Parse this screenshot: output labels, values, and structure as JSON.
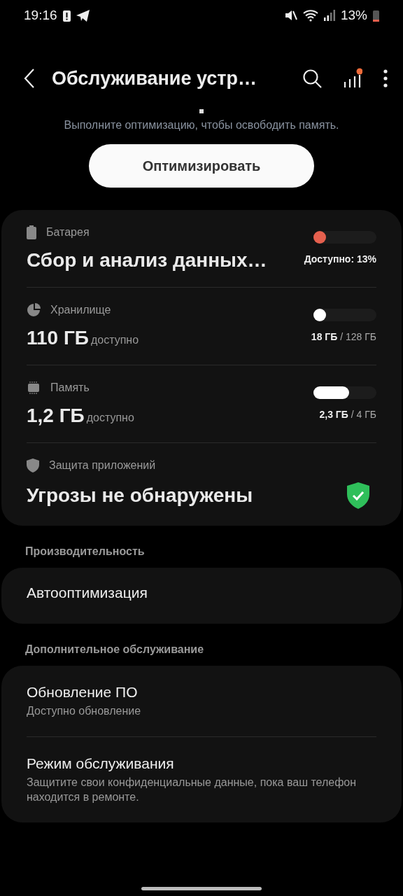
{
  "status_bar": {
    "time": "19:16",
    "battery_percent": "13%"
  },
  "header": {
    "title": "Обслуживание устр…",
    "notification_dot": true
  },
  "optimize": {
    "hint": "Выполните оптимизацию, чтобы освободить память.",
    "button": "Оптимизировать"
  },
  "overview": [
    {
      "kind": "battery",
      "label": "Батарея",
      "value": "Сбор и анализ данных…",
      "level": 0.13,
      "color": "#e5604e",
      "reading": "**Доступно: 13%**"
    },
    {
      "kind": "storage",
      "label": "Хранилище",
      "value": "110 ГБ",
      "unit": "доступно",
      "level": 0.14,
      "color": "#ffffff",
      "reading": "**18 ГБ** / 128 ГБ"
    },
    {
      "kind": "memory",
      "label": "Память",
      "value": "1,2 ГБ",
      "unit": "доступно",
      "level": 0.57,
      "color": "#ffffff",
      "reading": "**2,3 ГБ** / 4 ГБ"
    },
    {
      "kind": "security",
      "label": "Защита приложений",
      "value": "Угрозы не обнаружены"
    }
  ],
  "sections": [
    {
      "title": "Производительность",
      "items": [
        {
          "title": "Автооптимизация"
        }
      ]
    },
    {
      "title": "Дополнительное обслуживание",
      "items": [
        {
          "title": "Обновление ПО",
          "subtitle": "Доступно обновление"
        },
        {
          "title": "Режим обслуживания",
          "subtitle": "Защитите свои конфиденциальные данные, пока ваш телефон находится в ремонте."
        }
      ]
    }
  ]
}
